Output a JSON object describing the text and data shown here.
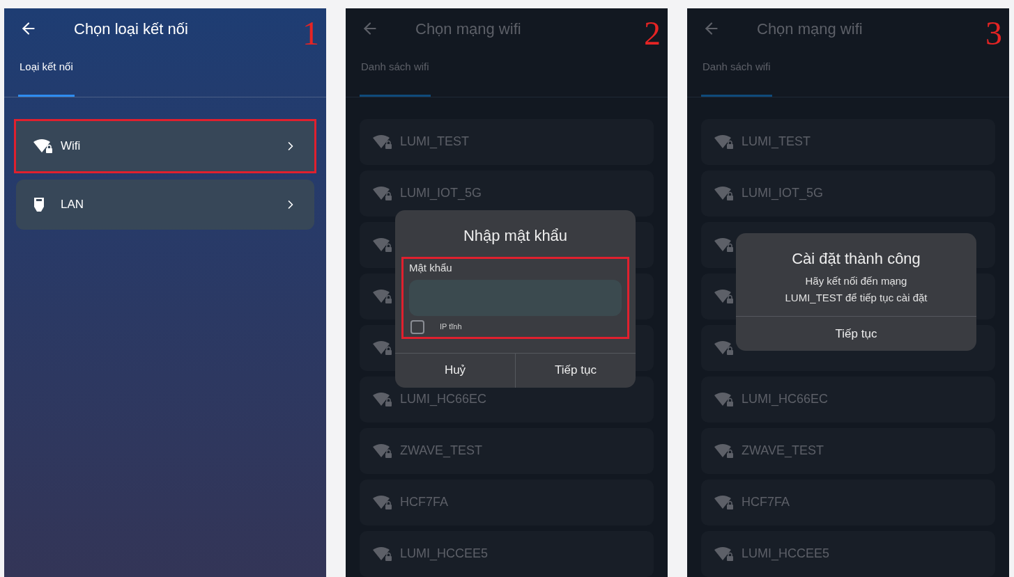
{
  "panels": [
    {
      "step": "1",
      "dimmed": false,
      "title": "Chọn loại kết nối",
      "tab": {
        "label": "Loại kết nối",
        "selected": true
      },
      "items": [
        {
          "label": "Wifi",
          "kind": "wifi",
          "highlighted": true
        },
        {
          "label": "LAN",
          "kind": "lan",
          "highlighted": false
        }
      ]
    },
    {
      "step": "2",
      "dimmed": true,
      "title": "Chọn mạng wifi",
      "tab": {
        "label": "Danh sách wifi",
        "selected": true
      },
      "networks": [
        {
          "kind": "named",
          "name": "LUMI_TEST"
        },
        {
          "kind": "named",
          "name": "LUMI_IOT_5G"
        },
        {
          "kind": "covered"
        },
        {
          "kind": "covered"
        },
        {
          "kind": "covered"
        },
        {
          "kind": "named",
          "name": "LUMI_HC66EC"
        },
        {
          "kind": "named",
          "name": "ZWAVE_TEST"
        },
        {
          "kind": "named",
          "name": "HCF7FA"
        },
        {
          "kind": "named",
          "name": "LUMI_HCCEE5"
        }
      ],
      "dialog": {
        "kind": "password",
        "title": "Nhập mật khẩu",
        "field_label": "Mật khẩu",
        "highlighted": true,
        "checkbox": {
          "label": "IP tĩnh",
          "checked": false
        },
        "buttons": [
          "Huỷ",
          "Tiếp tục"
        ]
      }
    },
    {
      "step": "3",
      "dimmed": true,
      "title": "Chọn mạng wifi",
      "tab": {
        "label": "Danh sách wifi",
        "selected": true
      },
      "networks": [
        {
          "kind": "named",
          "name": "LUMI_TEST"
        },
        {
          "kind": "named",
          "name": "LUMI_IOT_5G"
        },
        {
          "kind": "covered"
        },
        {
          "kind": "covered"
        },
        {
          "kind": "covered"
        },
        {
          "kind": "named",
          "name": "LUMI_HC66EC"
        },
        {
          "kind": "named",
          "name": "ZWAVE_TEST"
        },
        {
          "kind": "named",
          "name": "HCF7FA"
        },
        {
          "kind": "named",
          "name": "LUMI_HCCEE5"
        }
      ],
      "dialog": {
        "kind": "message",
        "title": "Cài đặt thành công",
        "message": "Hãy kết nối đến mạng\nLUMI_TEST để tiếp tục cài đặt",
        "buttons": [
          "Tiếp tục"
        ]
      }
    }
  ]
}
